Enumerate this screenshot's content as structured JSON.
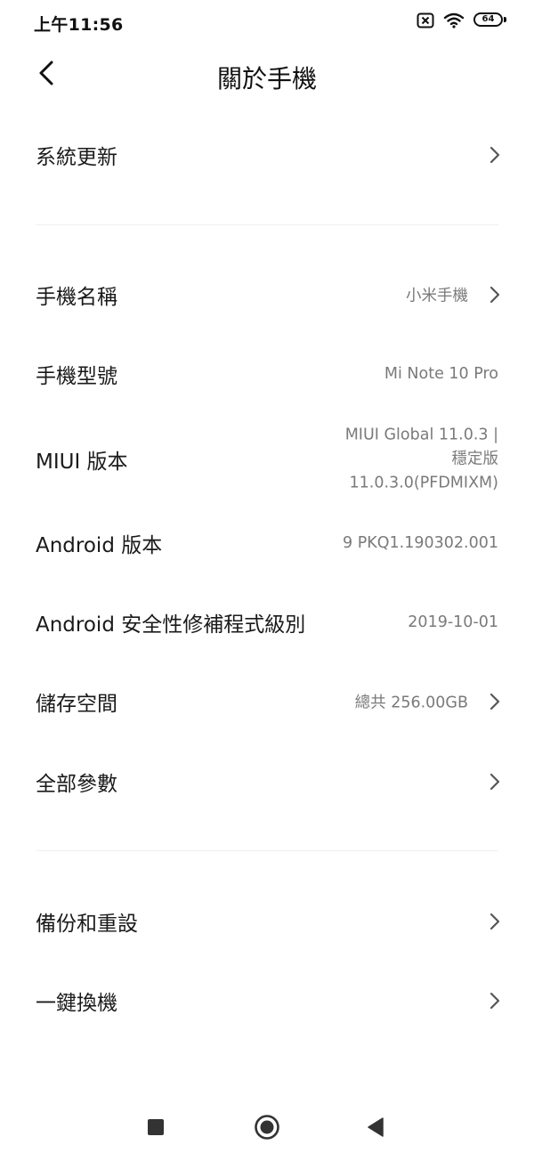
{
  "status_bar": {
    "time": "上午11:56",
    "battery_level": "64",
    "icons": [
      "no-sim-icon",
      "wifi-icon",
      "battery-icon"
    ]
  },
  "header": {
    "title": "關於手機",
    "back_icon": "chevron-left-icon"
  },
  "sections": [
    {
      "items": [
        {
          "label": "系統更新",
          "value": "",
          "has_chevron": true
        }
      ]
    },
    {
      "items": [
        {
          "label": "手機名稱",
          "value": "小米手機",
          "has_chevron": true
        },
        {
          "label": "手機型號",
          "value": "Mi Note 10 Pro",
          "has_chevron": false
        },
        {
          "label": "MIUI 版本",
          "value_lines": [
            "MIUI Global 11.0.3 |",
            "穩定版",
            "11.0.3.0(PFDMIXM)"
          ],
          "has_chevron": false
        },
        {
          "label": "Android 版本",
          "value": "9 PKQ1.190302.001",
          "has_chevron": false
        },
        {
          "label": "Android 安全性修補程式級別",
          "value": "2019-10-01",
          "has_chevron": false
        },
        {
          "label": "儲存空間",
          "value": "總共 256.00GB",
          "has_chevron": true
        },
        {
          "label": "全部參數",
          "value": "",
          "has_chevron": true
        }
      ]
    },
    {
      "items": [
        {
          "label": "備份和重設",
          "value": "",
          "has_chevron": true
        },
        {
          "label": "一鍵換機",
          "value": "",
          "has_chevron": true
        }
      ]
    }
  ],
  "nav_bar": {
    "icons": [
      "recents-square-icon",
      "home-circle-icon",
      "back-triangle-icon"
    ]
  },
  "colors": {
    "text_primary": "#1a1a1a",
    "text_secondary": "#7a7a7a",
    "background": "#ffffff",
    "divider": "#f0f0f0"
  }
}
